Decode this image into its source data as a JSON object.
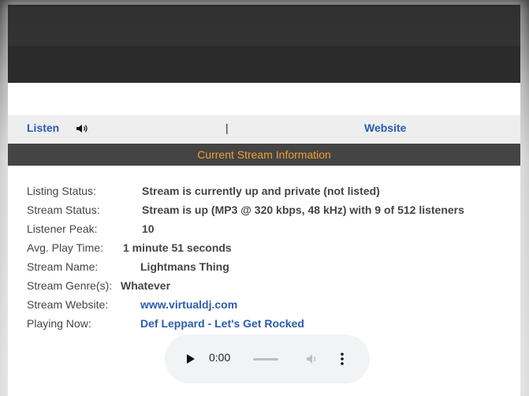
{
  "nav": {
    "listen_label": "Listen",
    "separator": "|",
    "website_label": "Website"
  },
  "section": {
    "title": "Current Stream Information"
  },
  "info": [
    {
      "label": "Listing Status:",
      "value": "Stream is currently up and private (not listed)"
    },
    {
      "label": "Stream Status:",
      "value": "Stream is up (MP3 @ 320 kbps, 48 kHz) with 9 of 512 listeners"
    },
    {
      "label": "Listener Peak:",
      "value": "10"
    },
    {
      "label": "Avg. Play Time:",
      "value": "1 minute 51 seconds"
    },
    {
      "label": "Stream Name:",
      "value": "Lightmans Thing"
    },
    {
      "label": "Stream Genre(s):",
      "value": "Whatever"
    },
    {
      "label": "Stream Website:",
      "value": "www.virtualdj.com"
    },
    {
      "label": "Playing Now:",
      "value": "Def Leppard - Let's Get Rocked"
    }
  ],
  "player": {
    "time": "0:00",
    "icons": [
      "play-icon",
      "volume-icon",
      "more-options-icon"
    ]
  },
  "colors": {
    "link": "#2a5db0",
    "header_bg": "#444444",
    "header_text": "#f0a030",
    "navbar_bg": "#eeeeee"
  }
}
